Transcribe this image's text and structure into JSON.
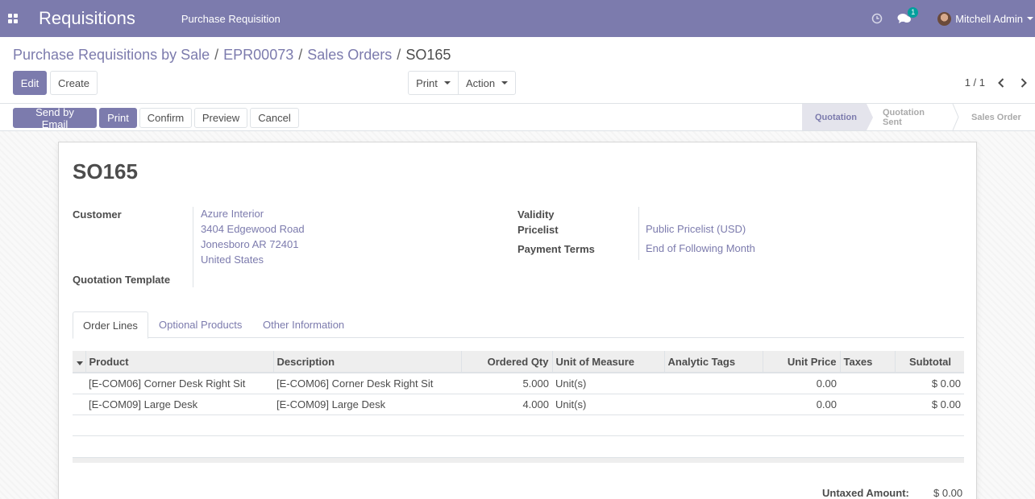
{
  "navbar": {
    "app_title": "Requisitions",
    "menu_item": "Purchase Requisition",
    "chat_count": "1",
    "user_name": "Mitchell Admin",
    "accent_color": "#7c7bad"
  },
  "breadcrumb": {
    "items": [
      "Purchase Requisitions by Sale",
      "EPR00073",
      "Sales Orders"
    ],
    "current": "SO165"
  },
  "controls": {
    "edit_label": "Edit",
    "create_label": "Create",
    "print_label": "Print",
    "action_label": "Action",
    "pager": "1 / 1"
  },
  "statusbar": {
    "send_email_label": "Send by Email",
    "print_label": "Print",
    "confirm_label": "Confirm",
    "preview_label": "Preview",
    "cancel_label": "Cancel",
    "stages": [
      "Quotation",
      "Quotation Sent",
      "Sales Order"
    ],
    "current_stage": "Quotation"
  },
  "form": {
    "title": "SO165",
    "customer_label": "Customer",
    "customer_name": "Azure Interior",
    "customer_address": [
      "3404 Edgewood Road",
      "Jonesboro AR 72401",
      "United States"
    ],
    "quotation_template_label": "Quotation Template",
    "validity_label": "Validity",
    "pricelist_label": "Pricelist",
    "pricelist_value": "Public Pricelist (USD)",
    "payment_terms_label": "Payment Terms",
    "payment_terms_value": "End of Following Month"
  },
  "tabs": {
    "order_lines": "Order Lines",
    "optional_products": "Optional Products",
    "other_information": "Other Information"
  },
  "order_lines": {
    "headers": {
      "product": "Product",
      "description": "Description",
      "ordered_qty": "Ordered Qty",
      "uom": "Unit of Measure",
      "analytic_tags": "Analytic Tags",
      "unit_price": "Unit Price",
      "taxes": "Taxes",
      "subtotal": "Subtotal"
    },
    "rows": [
      {
        "product": "[E-COM06] Corner Desk Right Sit",
        "description": "[E-COM06] Corner Desk Right Sit",
        "qty": "5.000",
        "uom": "Unit(s)",
        "tags": "",
        "price": "0.00",
        "taxes": "",
        "subtotal": "$ 0.00"
      },
      {
        "product": "[E-COM09] Large Desk",
        "description": "[E-COM09] Large Desk",
        "qty": "4.000",
        "uom": "Unit(s)",
        "tags": "",
        "price": "0.00",
        "taxes": "",
        "subtotal": "$ 0.00"
      }
    ]
  },
  "totals": {
    "untaxed_label": "Untaxed Amount:",
    "untaxed_value": "$ 0.00"
  }
}
